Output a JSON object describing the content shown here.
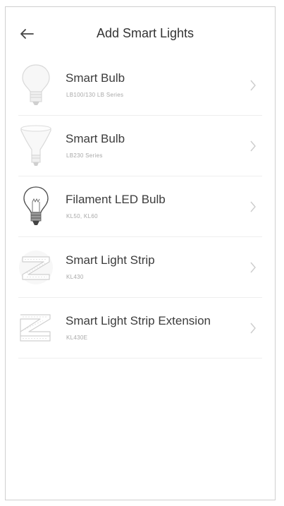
{
  "header": {
    "title": "Add Smart Lights",
    "back_icon": "arrow-left-icon"
  },
  "items": [
    {
      "name": "Smart Bulb",
      "model": "LB100/130 LB Series",
      "icon": "a19-bulb-icon"
    },
    {
      "name": "Smart Bulb",
      "model": "LB230 Series",
      "icon": "br30-bulb-icon"
    },
    {
      "name": "Filament LED Bulb",
      "model": "KL50, KL60",
      "icon": "filament-bulb-icon"
    },
    {
      "name": "Smart Light Strip",
      "model": "KL430",
      "icon": "light-strip-icon"
    },
    {
      "name": "Smart Light Strip Extension",
      "model": "KL430E",
      "icon": "light-strip-extension-icon"
    }
  ],
  "colors": {
    "text": "#333333",
    "subtext": "#a8a8a8",
    "divider": "#eeeeee",
    "chevron": "#cccccc"
  }
}
